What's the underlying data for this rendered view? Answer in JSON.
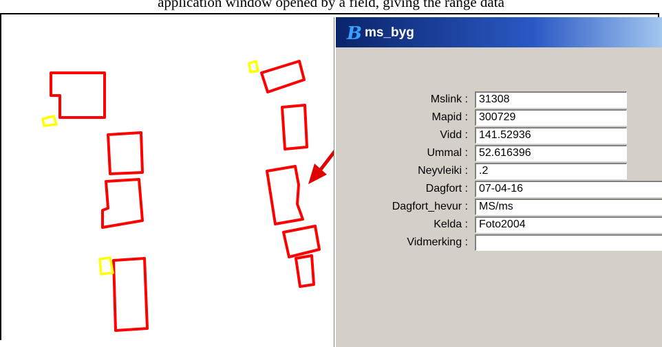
{
  "caption_fragment": "application window opened by a field, giving the range data",
  "dialog": {
    "title": "ms_byg",
    "icon": "bentley-b-icon",
    "fields": [
      {
        "label": "Mslink :",
        "value": "31308"
      },
      {
        "label": "Mapid :",
        "value": "300729"
      },
      {
        "label": "Vidd :",
        "value": "141.52936"
      },
      {
        "label": "Ummal :",
        "value": "52.616396"
      },
      {
        "label": "Neyvleiki :",
        "value": ".2"
      },
      {
        "label": "Dagfort :",
        "value": "07-04-16"
      },
      {
        "label": "Dagfort_hevur :",
        "value": "MS/ms"
      },
      {
        "label": "Kelda :",
        "value": "Foto2004"
      },
      {
        "label": "Vidmerking :",
        "value": ""
      }
    ]
  },
  "colors": {
    "building": "#ff0000",
    "annotation": "#ffff00",
    "arrow": "#e00000",
    "titlebar": "#0a246a"
  }
}
